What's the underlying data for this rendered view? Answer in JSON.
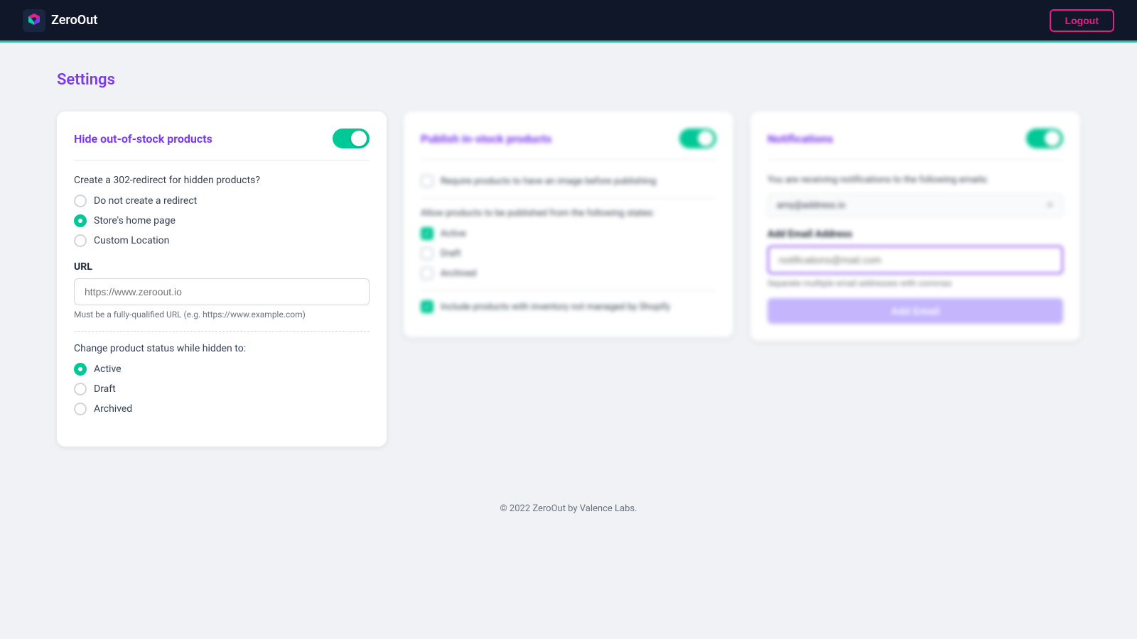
{
  "header": {
    "logo_text": "ZeroOut",
    "logout_label": "Logout"
  },
  "page": {
    "title": "Settings",
    "footer": "© 2022 ZeroOut by Valence Labs."
  },
  "card1": {
    "title": "Hide out-of-stock products",
    "toggle_on": true,
    "redirect_question": "Create a 302-redirect for hidden products?",
    "redirect_options": [
      {
        "label": "Do not create a redirect",
        "selected": false
      },
      {
        "label": "Store's home page",
        "selected": true
      },
      {
        "label": "Custom Location",
        "selected": false
      }
    ],
    "url_label": "URL",
    "url_placeholder": "https://www.zeroout.io",
    "url_hint": "Must be a fully-qualified URL (e.g. https://www.example.com)",
    "status_label": "Change product status while hidden to:",
    "status_options": [
      {
        "label": "Active",
        "selected": true
      },
      {
        "label": "Draft",
        "selected": false
      },
      {
        "label": "Archived",
        "selected": false
      }
    ]
  },
  "card2": {
    "title": "Publish in-stock products",
    "toggle_on": true,
    "require_image_label": "Require products to have an image before publishing",
    "require_image_checked": false,
    "states_label": "Allow products to be published from the following states:",
    "states": [
      {
        "label": "Active",
        "checked": true
      },
      {
        "label": "Draft",
        "checked": false
      },
      {
        "label": "Archived",
        "checked": false
      }
    ],
    "include_unmanaged_label": "Include products with inventory not managed by Shopify",
    "include_unmanaged_checked": true
  },
  "card3": {
    "title": "Notifications",
    "toggle_on": true,
    "receiving_text": "You are receiving notifications to the following emails:",
    "existing_email": "amy@address.io",
    "add_email_label": "Add Email Address",
    "add_email_placeholder": "notifications@mail.com",
    "add_email_hint": "Separate multiple email addresses with commas",
    "add_email_button": "Add Email"
  }
}
